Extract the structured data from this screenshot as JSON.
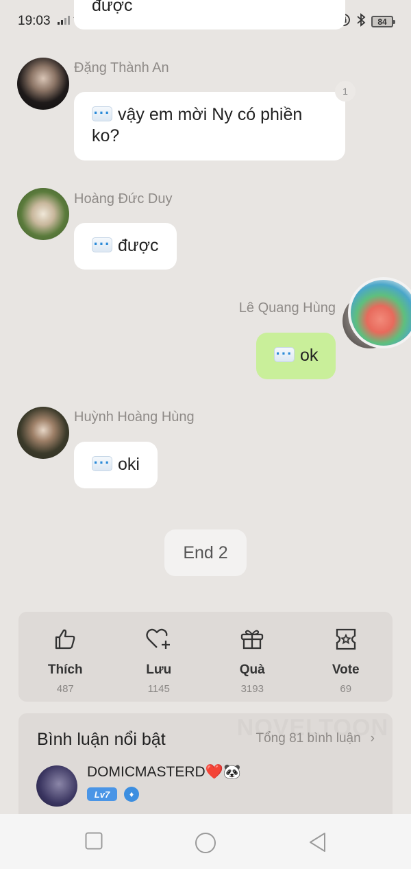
{
  "status": {
    "time": "19:03",
    "battery": "84"
  },
  "top_bubble": {
    "text": "được"
  },
  "messages": [
    {
      "name": "Đặng Thành An",
      "text": "vậy em mời Ny có phiền ko?",
      "badge": "1"
    },
    {
      "name": "Hoàng Đức Duy",
      "text": "được"
    },
    {
      "name": "Lê Quang Hùng",
      "text": "ok"
    },
    {
      "name": "Huỳnh Hoàng Hùng",
      "text": "oki"
    }
  ],
  "end_label": "End 2",
  "actions": [
    {
      "label": "Thích",
      "count": "487",
      "icon": "thumbs-up-icon"
    },
    {
      "label": "Lưu",
      "count": "1145",
      "icon": "heart-plus-icon"
    },
    {
      "label": "Quà",
      "count": "3193",
      "icon": "gift-icon"
    },
    {
      "label": "Vote",
      "count": "69",
      "icon": "ticket-star-icon"
    }
  ],
  "comments": {
    "title": "Bình luận nổi bật",
    "total": "Tổng 81 bình luận",
    "watermark": "NOVELTOON",
    "top_comment": {
      "username": "DOMICMASTERD❤️🐼",
      "level": "Lv7"
    }
  },
  "colors": {
    "background": "#e8e5e2",
    "my_bubble": "#c9ef9a",
    "level_badge": "#4a95e6"
  }
}
